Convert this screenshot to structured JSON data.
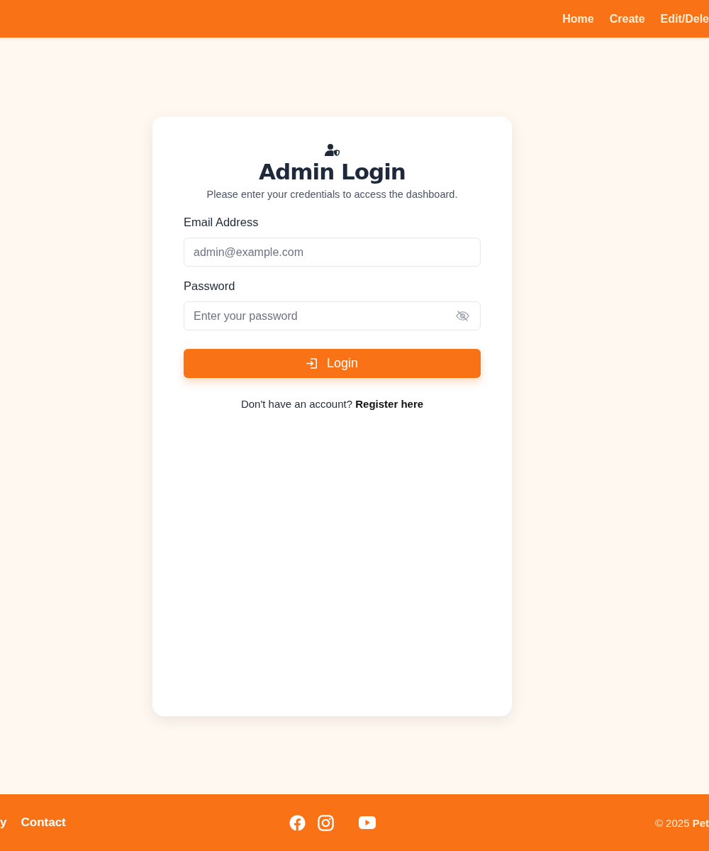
{
  "nav": {
    "links": [
      "Home",
      "Create",
      "Edit/Dele"
    ]
  },
  "login": {
    "title": "Admin Login",
    "subtitle": "Please enter your credentials to access the dashboard.",
    "fields": [
      {
        "kind": "email",
        "label": "Email Address",
        "placeholder": "admin@example.com"
      },
      {
        "kind": "password",
        "label": "Password",
        "placeholder": "Enter your password"
      }
    ],
    "button": "Login",
    "prompt": "Don't have an account?",
    "link": "Register here"
  },
  "footer": {
    "links": [
      "y",
      "Contact"
    ],
    "copyright": "© 2025 **Pet**"
  }
}
